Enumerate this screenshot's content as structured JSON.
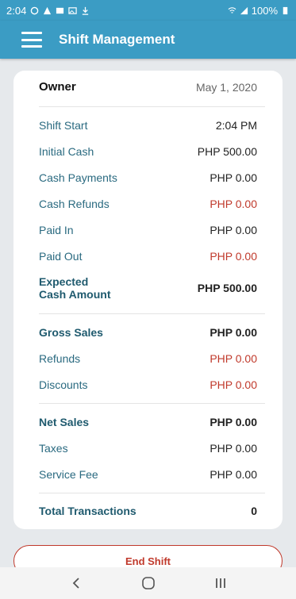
{
  "status": {
    "time": "2:04",
    "battery": "100%"
  },
  "app": {
    "title": "Shift Management"
  },
  "summary": {
    "owner_label": "Owner",
    "date": "May 1, 2020",
    "rows": [
      {
        "label": "Shift Start",
        "value": "2:04 PM"
      },
      {
        "label": "Initial Cash",
        "value": "PHP 500.00"
      },
      {
        "label": "Cash Payments",
        "value": "PHP 0.00"
      },
      {
        "label": "Cash Refunds",
        "value": "PHP 0.00"
      },
      {
        "label": "Paid In",
        "value": "PHP 0.00"
      },
      {
        "label": "Paid Out",
        "value": "PHP 0.00"
      }
    ],
    "expected": {
      "label_line1": "Expected",
      "label_line2": "Cash Amount",
      "value": "PHP 500.00"
    },
    "gross_sales": {
      "label": "Gross Sales",
      "value": "PHP 0.00"
    },
    "refunds": {
      "label": "Refunds",
      "value": "PHP 0.00"
    },
    "discounts": {
      "label": "Discounts",
      "value": "PHP 0.00"
    },
    "net_sales": {
      "label": "Net Sales",
      "value": "PHP 0.00"
    },
    "taxes": {
      "label": "Taxes",
      "value": "PHP 0.00"
    },
    "service_fee": {
      "label": "Service Fee",
      "value": "PHP 0.00"
    },
    "total_transactions": {
      "label": "Total Transactions",
      "value": "0"
    }
  },
  "actions": {
    "end_shift": "End Shift"
  },
  "colors": {
    "accent": "#3b9cc4",
    "negative": "#c0392b",
    "label": "#2a6a80"
  },
  "icons": [
    "menu-icon",
    "back-icon",
    "home-icon",
    "recents-icon",
    "wifi-icon",
    "signal-icon",
    "download-icon",
    "warning-icon"
  ]
}
